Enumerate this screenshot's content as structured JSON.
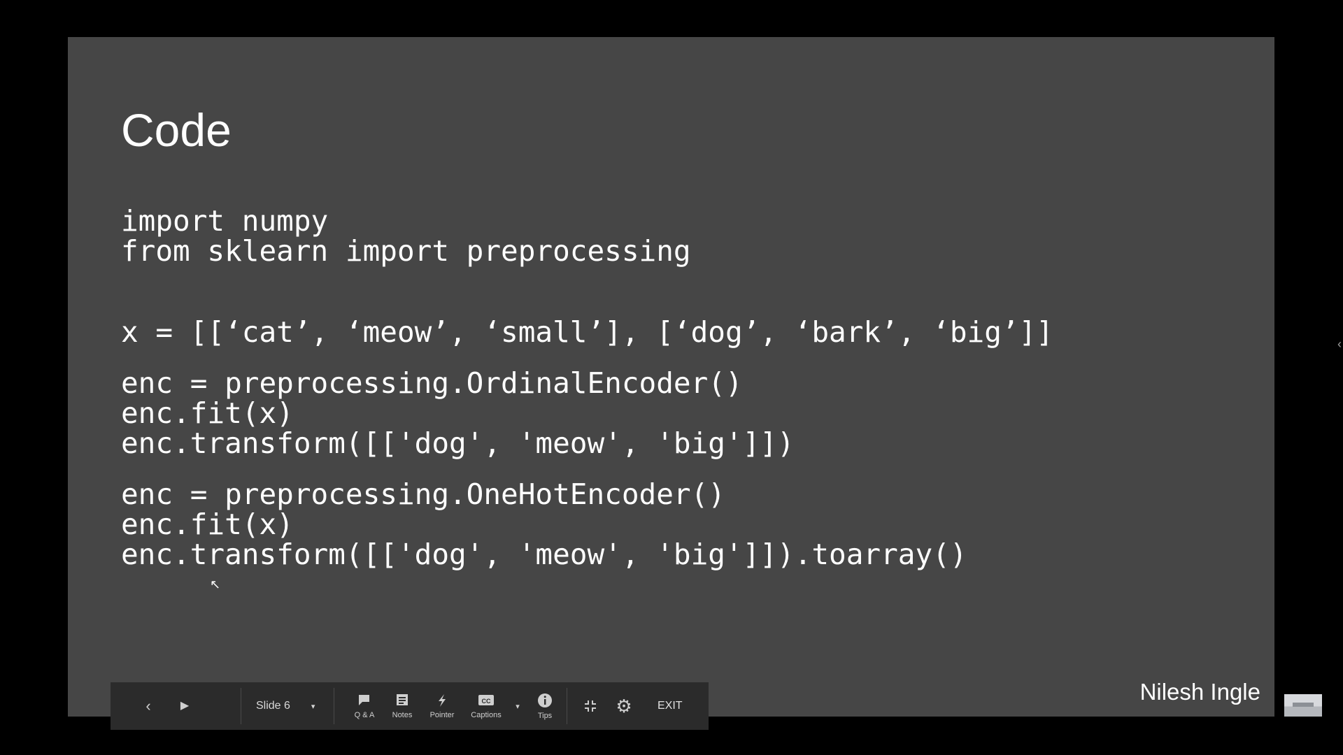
{
  "slide": {
    "title": "Code",
    "code_lines": [
      "import numpy",
      "from sklearn import preprocessing",
      "x = [[‘cat’, ‘meow’, ‘small’], [‘dog’, ‘bark’, ‘big’]]",
      "enc = preprocessing.OrdinalEncoder()",
      "enc.fit(x)",
      "enc.transform([['dog', 'meow', 'big']])",
      "enc = preprocessing.OneHotEncoder()",
      "enc.fit(x)",
      "enc.transform([['dog', 'meow', 'big']]).toarray()"
    ],
    "watermark": "Nilesh Ingle"
  },
  "toolbar": {
    "prev_icon": "chevron-left-icon",
    "play_icon": "play-icon",
    "slide_selector": "Slide 6",
    "qa_label": "Q & A",
    "notes_label": "Notes",
    "pointer_label": "Pointer",
    "captions_label": "Captions",
    "tips_label": "Tips",
    "exit_label": "EXIT"
  },
  "colors": {
    "background": "#000000",
    "slide_bg": "#464646",
    "toolbar_bg": "#2b2b2b",
    "text": "#ffffff"
  }
}
